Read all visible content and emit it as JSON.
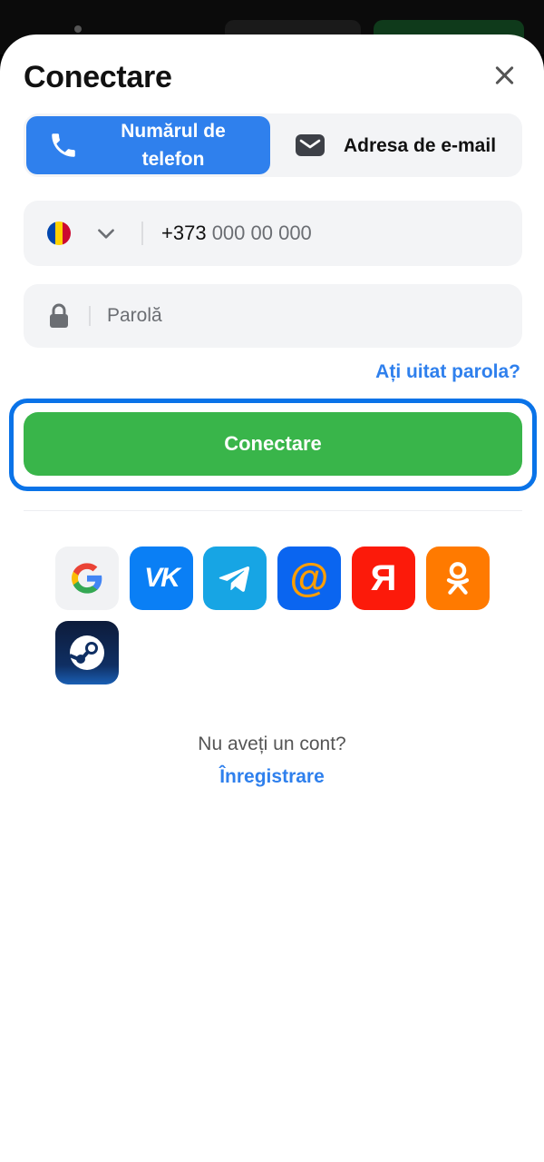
{
  "header": {
    "title": "Conectare"
  },
  "tabs": [
    {
      "label": "Numărul de telefon",
      "icon": "phone-icon",
      "active": true
    },
    {
      "label": "Adresa de e-mail",
      "icon": "mail-icon",
      "active": false
    }
  ],
  "phone": {
    "country_flag": "moldova-flag-icon",
    "prefix": "+373",
    "placeholder": "000 00 000"
  },
  "password": {
    "placeholder": "Parolă"
  },
  "forgot_label": "Ați uitat parola?",
  "login_label": "Conectare",
  "social": [
    {
      "name": "google-icon"
    },
    {
      "name": "vk-icon",
      "text": "VK"
    },
    {
      "name": "telegram-icon"
    },
    {
      "name": "mailru-icon",
      "text": "@"
    },
    {
      "name": "yandex-icon",
      "text": "Я"
    },
    {
      "name": "odnoklassniki-icon"
    },
    {
      "name": "steam-icon"
    }
  ],
  "footer": {
    "question": "Nu aveți un cont?",
    "register_label": "Înregistrare"
  },
  "colors": {
    "accent": "#2f80ed",
    "login": "#39b54a",
    "focus": "#0a73e8"
  }
}
